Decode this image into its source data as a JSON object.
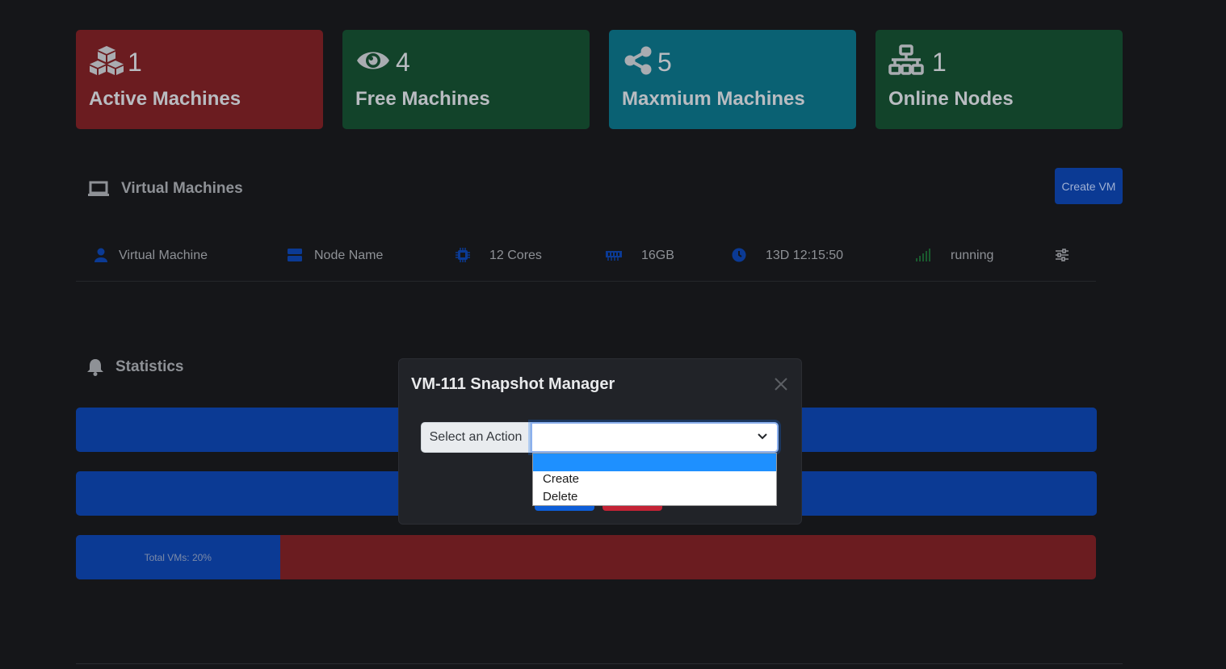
{
  "stats": [
    {
      "value": "1",
      "label": "Active Machines",
      "icon": "cubes-icon"
    },
    {
      "value": "4",
      "label": "Free Machines",
      "icon": "eye-icon"
    },
    {
      "value": "5",
      "label": "Maxmium Machines",
      "icon": "share-icon"
    },
    {
      "value": "1",
      "label": "Online Nodes",
      "icon": "network-icon"
    }
  ],
  "vm_section": {
    "title": "Virtual Machines",
    "create_button": "Create VM",
    "row": {
      "name": "Virtual Machine",
      "node": "Node Name",
      "cores": "12 Cores",
      "memory": "16GB",
      "uptime": "13D 12:15:50",
      "status": "running"
    }
  },
  "statistics": {
    "title": "Statistics",
    "total_vms_label": "Total VMs: 20%",
    "total_vms_percent": 20
  },
  "modal": {
    "title": "VM-111 Snapshot Manager",
    "addon_label": "Select an Action",
    "selected_value": "",
    "options": [
      "",
      "Create",
      "Delete"
    ]
  },
  "colors": {
    "danger": "#6b1c20",
    "success": "#12432a",
    "info": "#0a6173",
    "primary": "#0b3a94"
  }
}
